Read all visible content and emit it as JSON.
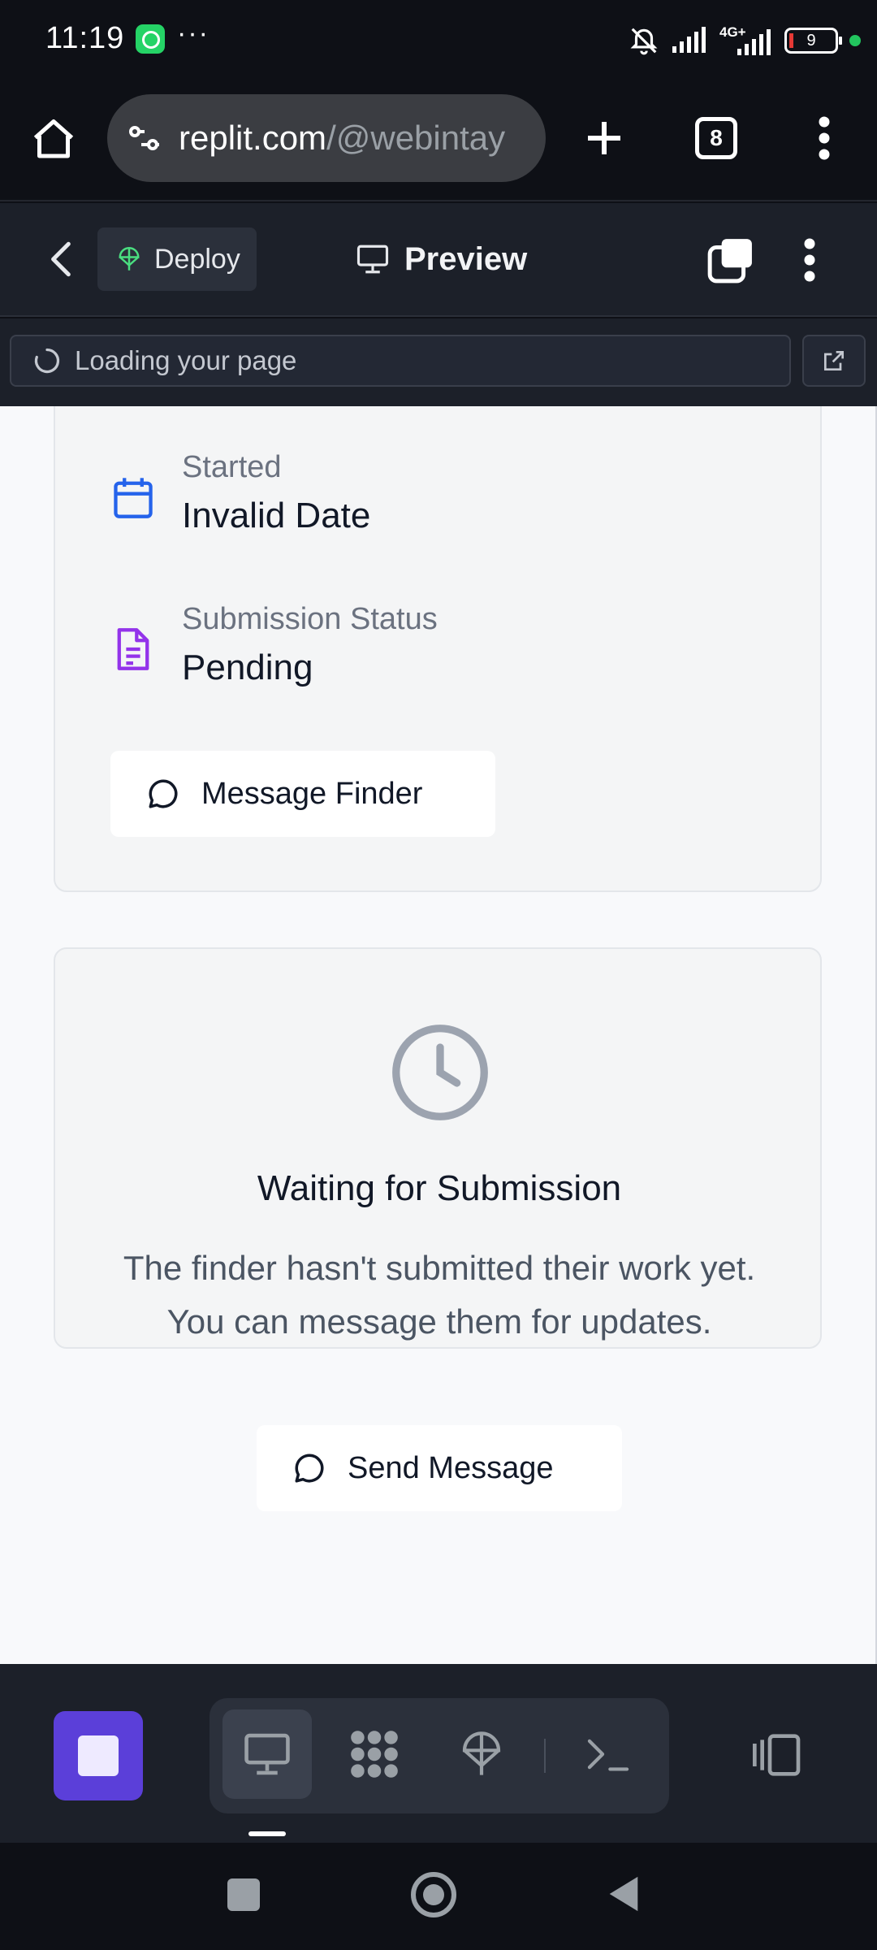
{
  "status_bar": {
    "time": "11:19",
    "more": "···",
    "network": "4G+",
    "battery": "9"
  },
  "browser": {
    "url_main": "replit.com",
    "url_dim": "/@webintay",
    "tab_count": "8"
  },
  "replit_header": {
    "deploy_label": "Deploy",
    "preview_label": "Preview"
  },
  "loading": {
    "text": "Loading your page"
  },
  "details": {
    "started_label": "Started",
    "started_value": "Invalid Date",
    "status_label": "Submission Status",
    "status_value": "Pending",
    "message_button": "Message Finder"
  },
  "waiting": {
    "title": "Waiting for Submission",
    "description": "The finder hasn't submitted their work yet. You can message them for updates.",
    "send_button": "Send Message"
  },
  "colors": {
    "accent_purple": "#5b3fd9",
    "calendar_icon": "#2563eb",
    "document_icon": "#9333ea",
    "deploy_icon": "#4ade80"
  }
}
